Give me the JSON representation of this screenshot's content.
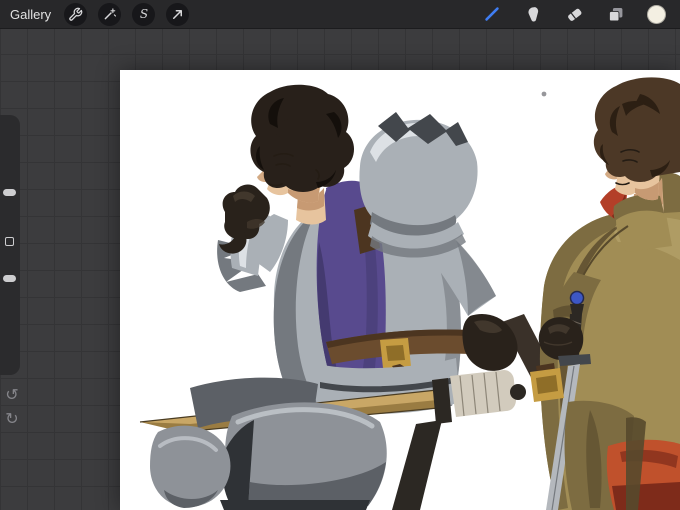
{
  "theme": {
    "accent": "#3f7df2",
    "toolbar_bg": "#28282a",
    "toolbar_border": "#1c1c1e",
    "workspace_bg": "#3c3c3e",
    "grid_line": "#343436",
    "panel_bg": "#2b2b2d",
    "circle_btn_bg": "#17171a",
    "icon": "#d8d8da",
    "icon_dim": "#85858a",
    "swatch": "#f3efe2",
    "canvas_bg": "#ffffff",
    "text": "#e2e2e2"
  },
  "toolbar": {
    "gallery_label": "Gallery",
    "tools_left": [
      {
        "id": "actions",
        "icon": "wrench-icon"
      },
      {
        "id": "adjustments",
        "icon": "magic-wand-icon"
      },
      {
        "id": "selection",
        "icon": "selection-s-icon",
        "glyph": "S"
      },
      {
        "id": "transform",
        "icon": "transform-arrow-icon"
      }
    ],
    "tools_right": [
      {
        "id": "paint",
        "icon": "brush-icon",
        "active": true
      },
      {
        "id": "smudge",
        "icon": "smudge-icon",
        "active": false
      },
      {
        "id": "erase",
        "icon": "eraser-icon",
        "active": false
      },
      {
        "id": "layers",
        "icon": "layers-icon",
        "active": false
      },
      {
        "id": "color",
        "icon": "color-swatch",
        "active": false
      }
    ],
    "active_tool": "paint",
    "selected_color": "#f3efe2"
  },
  "sidebar": {
    "controls": [
      {
        "id": "brush-size-slider"
      },
      {
        "id": "modify-button"
      },
      {
        "id": "opacity-slider"
      }
    ],
    "undo_icon": "↺",
    "redo_icon": "↻"
  },
  "canvas": {
    "artwork": {
      "subject": "digital illustration of two figures: knight in plate armor with purple tabard holding a sword, companion in olive coat with vertical sword",
      "palette": {
        "knight_armor": "#aab0b6",
        "knight_tabard": "#584a8e",
        "knight_hair": "#28201a",
        "skin": "#e7c49e",
        "belt": "#6b4c2e",
        "buckle": "#c59c42",
        "sword_blade_tan": "#c9a766",
        "gloves": "#29221b",
        "squire_coat": "#a18d55",
        "squire_hair": "#4c3826",
        "collar_red": "#b33f28",
        "lower_garment_orange": "#c0512c",
        "gem_blue": "#3d57c4"
      }
    }
  }
}
